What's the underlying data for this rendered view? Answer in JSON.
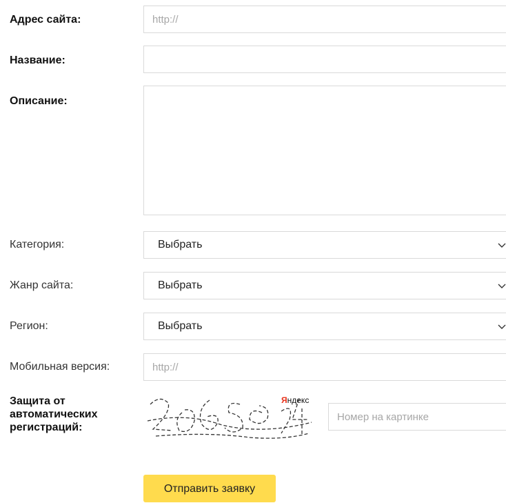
{
  "form": {
    "site_address": {
      "label": "Адрес сайта:",
      "placeholder": "http://"
    },
    "title": {
      "label": "Название:",
      "placeholder": ""
    },
    "description": {
      "label": "Описание:",
      "placeholder": ""
    },
    "category": {
      "label": "Категория:",
      "value": "Выбрать"
    },
    "genre": {
      "label": "Жанр сайта:",
      "value": "Выбрать"
    },
    "region": {
      "label": "Регион:",
      "value": "Выбрать"
    },
    "mobile_version": {
      "label": "Мобильная версия:",
      "placeholder": "http://"
    },
    "captcha": {
      "label_line1": "Защита от",
      "label_line2": "автоматических",
      "label_line3": "регистраций:",
      "image_text": "2965894",
      "brand": "Яндекс",
      "placeholder": "Номер на картинке"
    },
    "submit_label": "Отправить заявку"
  },
  "colors": {
    "button_bg": "#ffdb4d",
    "border": "#d9d9d9",
    "placeholder": "#a7a7a7",
    "brand_red": "#e8311a"
  }
}
